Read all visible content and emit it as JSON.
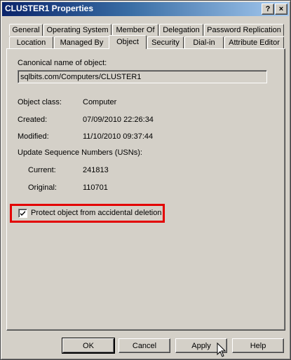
{
  "window": {
    "title": "CLUSTER1 Properties",
    "help_label": "?",
    "close_label": "×"
  },
  "tabs": {
    "row1": [
      "General",
      "Operating System",
      "Member Of",
      "Delegation",
      "Password Replication"
    ],
    "row2": [
      "Location",
      "Managed By",
      "Object",
      "Security",
      "Dial-in",
      "Attribute Editor"
    ],
    "active": "Object"
  },
  "object": {
    "canonical_label": "Canonical name of object:",
    "canonical_value": "sqlbits.com/Computers/CLUSTER1",
    "class_label": "Object class:",
    "class_value": "Computer",
    "created_label": "Created:",
    "created_value": "07/09/2010 22:26:34",
    "modified_label": "Modified:",
    "modified_value": "11/10/2010 09:37:44",
    "usn_label": "Update Sequence Numbers (USNs):",
    "current_label": "Current:",
    "current_value": "241813",
    "original_label": "Original:",
    "original_value": "110701",
    "protect_label": "Protect object from accidental deletion",
    "protect_checked": true
  },
  "buttons": {
    "ok": "OK",
    "cancel": "Cancel",
    "apply": "Apply",
    "help": "Help"
  },
  "colors": {
    "highlight": "#e30000",
    "titlebar_start": "#0a246a",
    "titlebar_end": "#a6caf0"
  }
}
